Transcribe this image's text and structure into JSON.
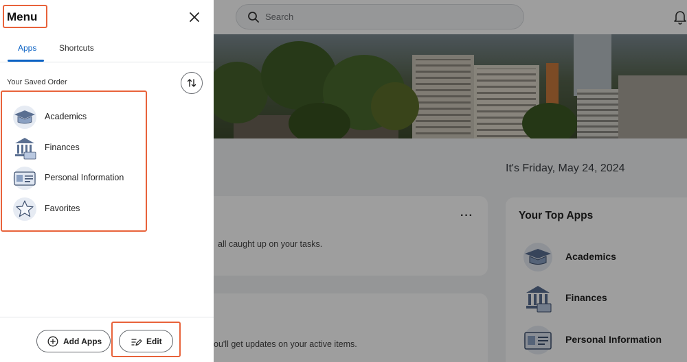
{
  "background": {
    "search_placeholder": "Search",
    "greeting": "It's Friday, May 24, 2024",
    "tasks_card": {
      "more_label": "···",
      "text": "all caught up on your tasks."
    },
    "updates_card": {
      "text": "ou'll get updates on your active items."
    },
    "top_apps": {
      "title": "Your Top Apps",
      "items": [
        {
          "label": "Academics",
          "icon": "graduation-cap-icon"
        },
        {
          "label": "Finances",
          "icon": "bank-icon"
        },
        {
          "label": "Personal Information",
          "icon": "id-card-icon"
        }
      ]
    }
  },
  "menu": {
    "title": "Menu",
    "close_icon": "close-icon",
    "tabs": [
      {
        "label": "Apps",
        "active": true
      },
      {
        "label": "Shortcuts",
        "active": false
      }
    ],
    "saved_order_label": "Your Saved Order",
    "sort_icon": "swap-vertical-icon",
    "items": [
      {
        "label": "Academics",
        "icon": "graduation-cap-icon"
      },
      {
        "label": "Finances",
        "icon": "bank-icon"
      },
      {
        "label": "Personal Information",
        "icon": "id-card-icon"
      },
      {
        "label": "Favorites",
        "icon": "star-icon"
      }
    ],
    "add_apps_label": "Add Apps",
    "edit_label": "Edit"
  },
  "colors": {
    "accent_blue": "#0b62c4",
    "highlight_orange": "#e8623a",
    "overlay": "rgba(0,0,0,0.38)"
  }
}
